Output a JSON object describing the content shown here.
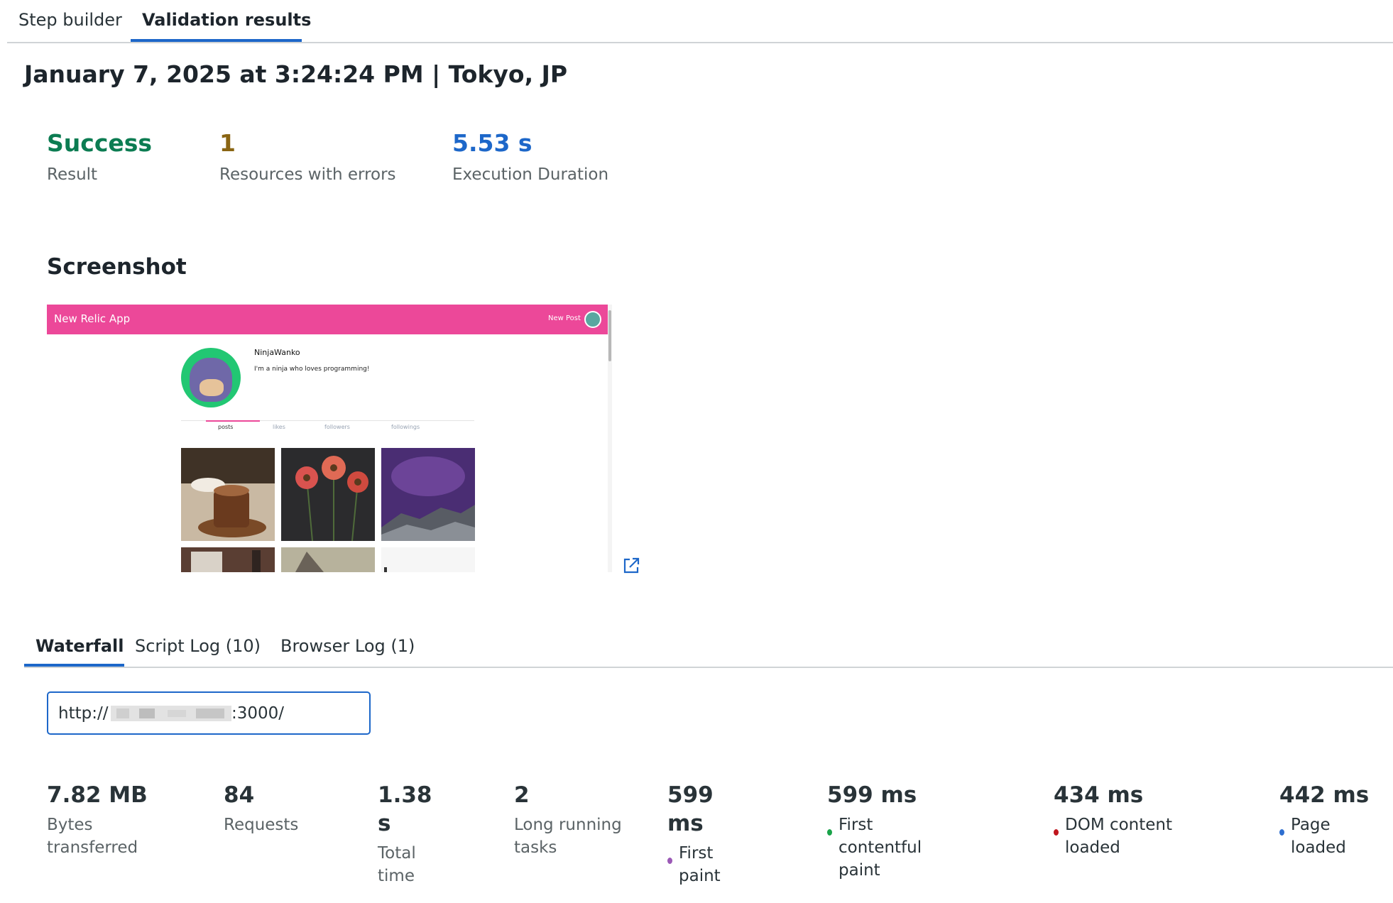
{
  "top_tabs": {
    "step_builder": "Step builder",
    "validation_results": "Validation results"
  },
  "run": {
    "title": "January 7, 2025 at 3:24:24 PM | Tokyo, JP"
  },
  "summary": {
    "result_value": "Success",
    "result_label": "Result",
    "errors_value": "1",
    "errors_label": "Resources with errors",
    "duration_value": "5.53 s",
    "duration_label": "Execution Duration"
  },
  "screenshot": {
    "title": "Screenshot",
    "app_title": "New Relic App",
    "new_post": "New Post",
    "username": "NinjaWanko",
    "bio": "I'm a ninja who loves programming!",
    "tabs": [
      "posts",
      "likes",
      "followers",
      "followings"
    ]
  },
  "sub_tabs": {
    "waterfall": "Waterfall",
    "script_log": "Script Log (10)",
    "browser_log": "Browser Log (1)"
  },
  "url_select": {
    "prefix": "http://",
    "suffix": ":3000/"
  },
  "metrics": {
    "bytes_value": "7.82 MB",
    "bytes_label": "Bytes transferred",
    "requests_value": "84",
    "requests_label": "Requests",
    "total_value": "1.38 s",
    "total_label": "Total time",
    "long_value": "2",
    "long_label": "Long running tasks",
    "fp_value": "599 ms",
    "fp_label": "First paint",
    "fcp_value": "599 ms",
    "fcp_label": "First contentful paint",
    "dcl_value": "434 ms",
    "dcl_label": "DOM content loaded",
    "pl_value": "442 ms",
    "pl_label": "Page loaded"
  },
  "colors": {
    "accent": "#1d67c9",
    "success": "#0c7c52",
    "warning": "#8a6513",
    "app_pink": "#ec4899",
    "fp_dot": "#9b59b6",
    "fcp_dot": "#1aa34a",
    "dcl_dot": "#c0161e",
    "pl_dot": "#2e6fd0"
  }
}
